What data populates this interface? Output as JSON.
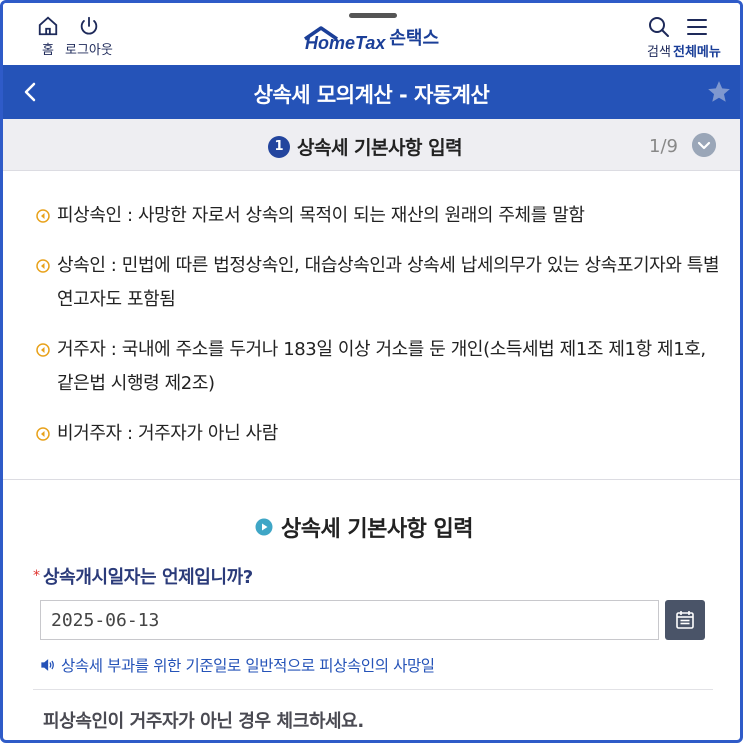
{
  "header": {
    "home_label": "홈",
    "logout_label": "로그아웃",
    "logo_en": "HomeTax",
    "logo_ko": "손택스",
    "search_label": "검색",
    "menu_label": "전체메뉴"
  },
  "titlebar": {
    "title": "상속세 모의계산 - 자동계산"
  },
  "step": {
    "number": "1",
    "title": "상속세 기본사항 입력",
    "count": "1/9"
  },
  "definitions": [
    {
      "text": "피상속인 : 사망한 자로서 상속의 목적이 되는 재산의 원래의 주체를 말함"
    },
    {
      "text": "상속인 : 민법에 따른 법정상속인, 대습상속인과 상속세 납세의무가 있는 상속포기자와 특별연고자도 포함됨"
    },
    {
      "text": "거주자 : 국내에 주소를 두거나 183일 이상 거소를 둔 개인(소득세법 제1조 제1항 제1호, 같은법 시행령 제2조)"
    },
    {
      "text": "비거주자 : 거주자가 아닌 사람"
    }
  ],
  "form": {
    "section_title": "상속세 기본사항 입력",
    "question1": "상속개시일자는 언제입니까?",
    "required_mark": "*",
    "date_value": "2025-06-13",
    "hint": "상속세 부과를 위한 기준일로 일반적으로 피상속인의 사망일",
    "question2": "피상속인이 거주자가 아닌 경우 체크하세요."
  },
  "colors": {
    "primary": "#2553b8",
    "navy": "#1b3f98",
    "bullet": "#e8a21c",
    "section_icon": "#3fa6c6"
  }
}
